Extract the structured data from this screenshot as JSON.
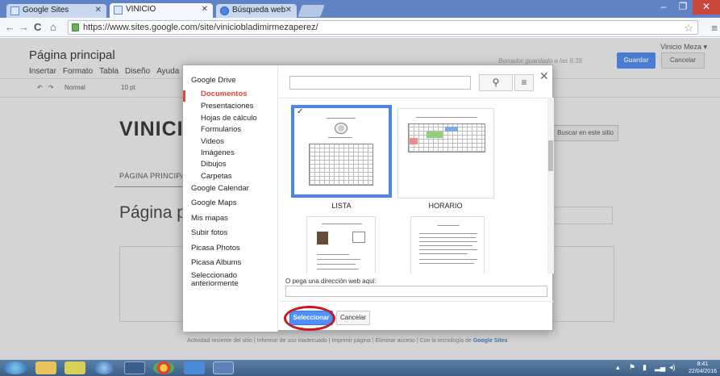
{
  "browser": {
    "tabs": [
      {
        "title": "Google Sites",
        "icon": "sites-icon"
      },
      {
        "title": "VINICIO",
        "icon": "sites-icon"
      },
      {
        "title": "Búsqueda web",
        "icon": "search-icon"
      }
    ],
    "url": "https://www.sites.google.com/site/viniciobladimirmezaperez/"
  },
  "page": {
    "user": "Vinicio Meza ▾",
    "heading": "Página principal",
    "editor_menu": [
      "Insertar",
      "Formato",
      "Tabla",
      "Diseño",
      "Ayuda"
    ],
    "saved_status": "Borrador guardado a las 6:38",
    "save_label": "Guardar",
    "cancel_label": "Cancelar",
    "format": {
      "style": "Normal",
      "size": "10 pt"
    },
    "site_title": "VINICIO",
    "site_search": "Buscar en este sitio",
    "nav_tab": "PÁGINA PRINCIPAL",
    "content_heading": "Página pr",
    "footer": {
      "links": "Actividad reciente del sitio | Informar de uso inadecuado | Imprimir página | Eliminar acceso | Con la tecnología de",
      "brand": "Google Sites"
    }
  },
  "dialog": {
    "nav": [
      {
        "label": "Google Drive",
        "sub": false,
        "active": false
      },
      {
        "label": "Documentos",
        "sub": true,
        "active": true
      },
      {
        "label": "Presentaciones",
        "sub": true,
        "active": false
      },
      {
        "label": "Hojas de cálculo",
        "sub": true,
        "active": false
      },
      {
        "label": "Formularios",
        "sub": true,
        "active": false
      },
      {
        "label": "Videos",
        "sub": true,
        "active": false
      },
      {
        "label": "Imágenes",
        "sub": true,
        "active": false
      },
      {
        "label": "Dibujos",
        "sub": true,
        "active": false
      },
      {
        "label": "Carpetas",
        "sub": true,
        "active": false
      },
      {
        "label": "Google Calendar",
        "sub": false,
        "active": false
      },
      {
        "label": "Google Maps",
        "sub": false,
        "active": false
      },
      {
        "label": "Mis mapas",
        "sub": false,
        "active": false
      },
      {
        "label": "Subir fotos",
        "sub": false,
        "active": false
      },
      {
        "label": "Picasa Photos",
        "sub": false,
        "active": false
      },
      {
        "label": "Picasa Albums",
        "sub": false,
        "active": false
      },
      {
        "label": "Seleccionado\nanteriormente",
        "sub": false,
        "active": false
      }
    ],
    "files": [
      {
        "name": "LISTA",
        "selected": true
      },
      {
        "name": "HORARIO",
        "selected": false
      },
      {
        "name": "",
        "selected": false
      },
      {
        "name": "",
        "selected": false
      }
    ],
    "url_label": "O pega una dirección web aquí:",
    "select_label": "Seleccionar",
    "cancel_label": "Cancelar",
    "accent": "#4a86e8",
    "highlight_color": "#c9191e"
  },
  "taskbar": {
    "clock_time": "8:41",
    "clock_date": "22/04/2016"
  }
}
